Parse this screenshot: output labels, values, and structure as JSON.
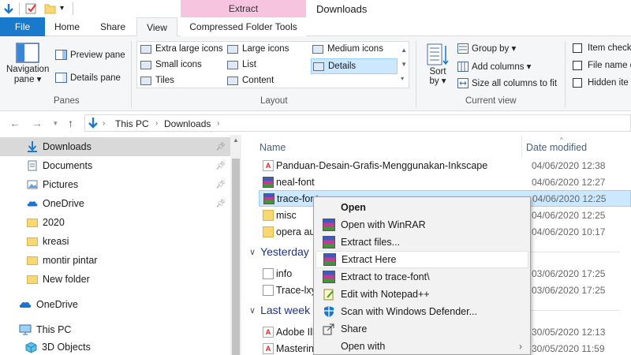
{
  "window": {
    "title": "Downloads",
    "contextual_tab_header": "Extract"
  },
  "tabs": {
    "file": "File",
    "home": "Home",
    "share": "Share",
    "view": "View",
    "compressed": "Compressed Folder Tools"
  },
  "ribbon": {
    "panes": {
      "navigation_pane_line1": "Navigation",
      "navigation_pane_line2": "pane ▾",
      "preview_pane": "Preview pane",
      "details_pane": "Details pane",
      "label": "Panes"
    },
    "layout": {
      "extra_large_icons": "Extra large icons",
      "large_icons": "Large icons",
      "medium_icons": "Medium icons",
      "small_icons": "Small icons",
      "list": "List",
      "details": "Details",
      "tiles": "Tiles",
      "content": "Content",
      "label": "Layout"
    },
    "current_view": {
      "sort_by_line1": "Sort",
      "sort_by_line2": "by ▾",
      "group_by": "Group by ▾",
      "add_columns": "Add columns ▾",
      "size_all_columns": "Size all columns to fit",
      "label": "Current view"
    },
    "show_hide": {
      "item_check": "Item check",
      "file_name_ext": "File name e",
      "hidden_items": "Hidden ite"
    }
  },
  "address": {
    "crumbs": [
      "This PC",
      "Downloads"
    ]
  },
  "nav": {
    "items": [
      {
        "label": "Downloads",
        "pinned": true
      },
      {
        "label": "Documents",
        "pinned": true
      },
      {
        "label": "Pictures",
        "pinned": true
      },
      {
        "label": "OneDrive",
        "pinned": true
      },
      {
        "label": "2020"
      },
      {
        "label": "kreasi"
      },
      {
        "label": "montir pintar"
      },
      {
        "label": "New folder"
      },
      {
        "label": "OneDrive"
      },
      {
        "label": "This PC"
      },
      {
        "label": "3D Objects"
      }
    ]
  },
  "files": {
    "col_name": "Name",
    "col_date": "Date modified",
    "today": [
      {
        "name": "Panduan-Desain-Grafis-Menggunakan-Inkscape",
        "date": "04/06/2020 12:38",
        "type": "pdf"
      },
      {
        "name": "neal-font",
        "date": "04/06/2020 12:27",
        "type": "rar"
      },
      {
        "name": "trace-font",
        "date": "04/06/2020 12:25",
        "type": "rar"
      },
      {
        "name": "misc",
        "date": "04/06/2020 12:25",
        "type": "folder"
      },
      {
        "name": "opera autoupdate",
        "date": "04/06/2020 10:17",
        "type": "folder"
      }
    ],
    "group_yesterday": "Yesterday",
    "yesterday": [
      {
        "name": "info",
        "date": "03/06/2020 17:25",
        "type": "txt"
      },
      {
        "name": "Trace-lxyz",
        "date": "03/06/2020 17:25",
        "type": "txt"
      }
    ],
    "group_lastweek": "Last week",
    "lastweek": [
      {
        "name": "Adobe Illustrator",
        "date": "30/05/2020 12:13",
        "type": "pdf"
      },
      {
        "name": "Mastering",
        "date": "30/05/2020 11:59",
        "type": "pdf"
      }
    ]
  },
  "context_menu": {
    "items": [
      {
        "label": "Open",
        "bold": true,
        "icon": "none"
      },
      {
        "label": "Open with WinRAR",
        "icon": "winrar-icon"
      },
      {
        "label": "Extract files...",
        "icon": "winrar-icon"
      },
      {
        "label": "Extract Here",
        "icon": "winrar-icon",
        "highlighted": true
      },
      {
        "label": "Extract to trace-font\\",
        "icon": "winrar-icon"
      },
      {
        "label": "Edit with Notepad++",
        "icon": "notepadpp-icon"
      },
      {
        "label": "Scan with Windows Defender...",
        "icon": "defender-icon"
      },
      {
        "label": "Share",
        "icon": "share-icon"
      },
      {
        "label": "Open with",
        "icon": "none",
        "submenu": true
      }
    ]
  },
  "colors": {
    "file_tab": "#1979ca",
    "selection": "#cce8ff",
    "context_tab": "#f7c4e0",
    "group_header": "#1e3287"
  }
}
